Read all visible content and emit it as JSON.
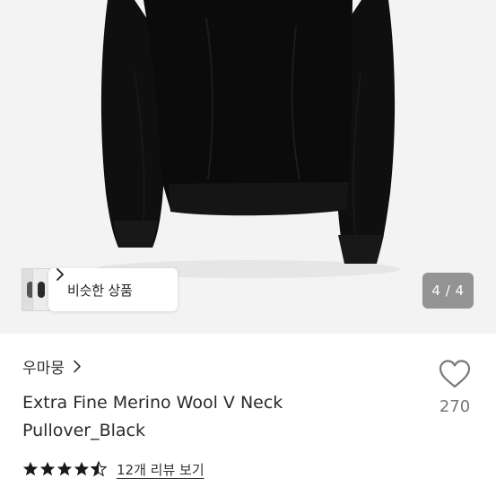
{
  "image": {
    "page_indicator": "4 / 4",
    "similar_button_label": "비슷한 상품"
  },
  "product": {
    "brand": "우마뭉",
    "title_line1": "Extra Fine Merino Wool V Neck",
    "title_line2": "Pullover_Black",
    "like_count": "270",
    "rating": 4.5,
    "review_link": "12개 리뷰 보기"
  },
  "colors": {
    "sweater": "#0d0d0d",
    "image_bg": "#f3f3f3",
    "text": "#222222",
    "muted": "#777777"
  },
  "icons": [
    "chevron-right-icon",
    "heart-outline-icon",
    "star-full-icon",
    "star-half-icon"
  ]
}
